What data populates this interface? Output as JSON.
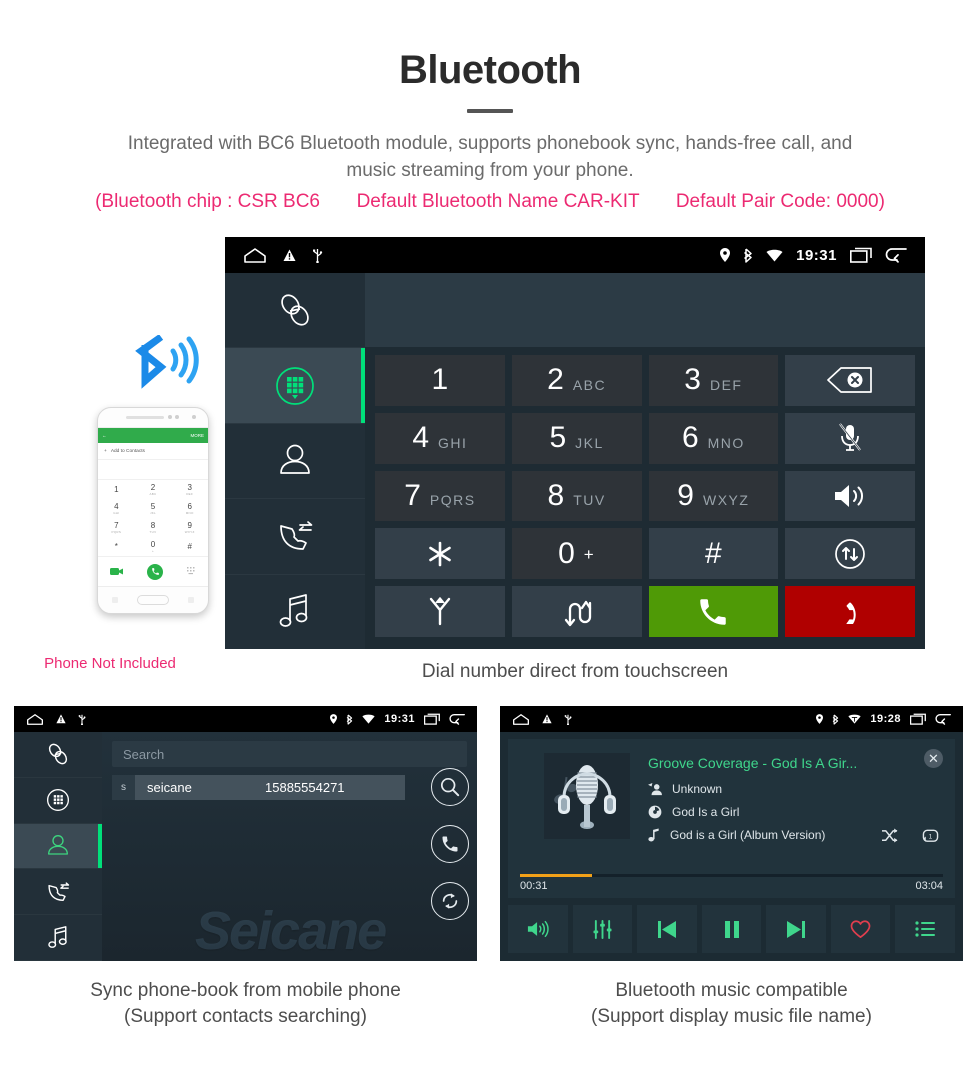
{
  "header": {
    "title": "Bluetooth",
    "subtitle_line1": "Integrated with BC6 Bluetooth module, supports phonebook sync, hands-free call, and",
    "subtitle_line2": "music streaming from your phone.",
    "chip_info": "(Bluetooth chip : CSR BC6",
    "default_name": "Default Bluetooth Name CAR-KIT",
    "pair_code": "Default Pair Code: 0000)",
    "accent_pink": "#ec2a72",
    "title_color": "#2b2b2b"
  },
  "dialer_screen": {
    "statusbar": {
      "home_icon": "home-icon",
      "warning_icon": "warning-icon",
      "usb_icon": "usb-icon",
      "location_icon": "location-icon",
      "bluetooth_icon": "bluetooth-icon",
      "wifi_icon": "wifi-icon",
      "time": "19:31",
      "recents_icon": "recents-icon",
      "back_icon": "back-icon"
    },
    "sidebar": [
      {
        "name": "pair-link",
        "icon": "link-icon",
        "active": false
      },
      {
        "name": "dialpad",
        "icon": "dialpad-icon",
        "active": true
      },
      {
        "name": "contacts",
        "icon": "person-icon",
        "active": false
      },
      {
        "name": "call-history",
        "icon": "call-history-icon",
        "active": false
      },
      {
        "name": "music",
        "icon": "music-note-icon",
        "active": false
      }
    ],
    "number_display": "",
    "keys": [
      {
        "num": "1",
        "letters": "",
        "type": "digit"
      },
      {
        "num": "2",
        "letters": "ABC",
        "type": "digit"
      },
      {
        "num": "3",
        "letters": "DEF",
        "type": "digit"
      },
      {
        "num": "",
        "letters": "",
        "type": "fn",
        "icon": "backspace-icon"
      },
      {
        "num": "4",
        "letters": "GHI",
        "type": "digit"
      },
      {
        "num": "5",
        "letters": "JKL",
        "type": "digit"
      },
      {
        "num": "6",
        "letters": "MNO",
        "type": "digit"
      },
      {
        "num": "",
        "letters": "",
        "type": "fn",
        "icon": "mic-mute-icon"
      },
      {
        "num": "7",
        "letters": "PQRS",
        "type": "digit"
      },
      {
        "num": "8",
        "letters": "TUV",
        "type": "digit"
      },
      {
        "num": "9",
        "letters": "WXYZ",
        "type": "digit"
      },
      {
        "num": "",
        "letters": "",
        "type": "fn",
        "icon": "speaker-icon"
      },
      {
        "num": "",
        "letters": "",
        "type": "fn",
        "icon": "asterisk-icon"
      },
      {
        "num": "0",
        "letters": "+",
        "type": "digit-plus"
      },
      {
        "num": "#",
        "letters": "",
        "type": "fn"
      },
      {
        "num": "",
        "letters": "",
        "type": "fn",
        "icon": "transfer-circle-icon"
      },
      {
        "num": "",
        "letters": "",
        "type": "fn",
        "icon": "merge-call-icon"
      },
      {
        "num": "",
        "letters": "",
        "type": "fn",
        "icon": "swap-call-icon"
      },
      {
        "num": "",
        "letters": "",
        "type": "call",
        "icon": "call-icon"
      },
      {
        "num": "",
        "letters": "",
        "type": "end",
        "icon": "hangup-icon"
      }
    ],
    "caption": "Dial number direct from touchscreen",
    "colors": {
      "call_green": "#4f9a06",
      "end_red": "#b00000",
      "active_green": "#00e07a"
    }
  },
  "phone_illustration": {
    "bluetooth_badge_icon": "bluetooth-signal-icon",
    "screen": {
      "topbar_back_icon": "back-arrow-icon",
      "topbar_more": "MORE",
      "add_contacts": "Add to Contacts",
      "keys": [
        {
          "n": "1",
          "s": ""
        },
        {
          "n": "2",
          "s": "ABC"
        },
        {
          "n": "3",
          "s": "DEF"
        },
        {
          "n": "4",
          "s": "GHI"
        },
        {
          "n": "5",
          "s": "JKL"
        },
        {
          "n": "6",
          "s": "MNO"
        },
        {
          "n": "7",
          "s": "PQRS"
        },
        {
          "n": "8",
          "s": "TUV"
        },
        {
          "n": "9",
          "s": "WXYZ"
        },
        {
          "n": "*",
          "s": ""
        },
        {
          "n": "0",
          "s": "+"
        },
        {
          "n": "#",
          "s": ""
        }
      ],
      "video_call_icon": "video-call-icon",
      "call_icon": "call-icon",
      "keypad_hide_icon": "keypad-hide-icon"
    },
    "caption": "Phone Not Included"
  },
  "contacts_screen": {
    "statusbar": {
      "time": "19:31"
    },
    "sidebar": [
      {
        "name": "pair-link",
        "icon": "link-icon",
        "active": false
      },
      {
        "name": "dialpad",
        "icon": "dialpad-icon",
        "active": false
      },
      {
        "name": "contacts",
        "icon": "person-icon",
        "active": true
      },
      {
        "name": "call-history",
        "icon": "call-history-icon",
        "active": false
      },
      {
        "name": "music",
        "icon": "music-note-icon",
        "active": false
      }
    ],
    "search_placeholder": "Search",
    "contacts": [
      {
        "initial": "s",
        "name": "seicane",
        "number": "15885554271"
      }
    ],
    "actions": [
      {
        "name": "search-button",
        "icon": "search-icon"
      },
      {
        "name": "call-button",
        "icon": "call-icon"
      },
      {
        "name": "sync-button",
        "icon": "sync-icon"
      }
    ],
    "caption_line1": "Sync phone-book from mobile phone",
    "caption_line2": "(Support contacts searching)"
  },
  "music_screen": {
    "statusbar": {
      "time": "19:28"
    },
    "track_title": "Groove Coverage - God Is A Gir...",
    "artist": "Unknown",
    "album": "God Is a Girl",
    "file_name": "God is a Girl (Album Version)",
    "artist_icon": "artist-icon",
    "album_icon": "album-disc-icon",
    "file_icon": "music-note-icon",
    "shuffle_icon": "shuffle-icon",
    "repeat_icon": "repeat-one-icon",
    "close_icon": "close-icon",
    "time_elapsed": "00:31",
    "time_total": "03:04",
    "progress_percent": 17,
    "progress_color": "#f2a118",
    "controls": [
      {
        "name": "volume-button",
        "icon": "volume-icon"
      },
      {
        "name": "equalizer-button",
        "icon": "equalizer-icon"
      },
      {
        "name": "previous-button",
        "icon": "previous-icon"
      },
      {
        "name": "pause-button",
        "icon": "pause-icon"
      },
      {
        "name": "next-button",
        "icon": "next-icon"
      },
      {
        "name": "favorite-button",
        "icon": "heart-icon"
      },
      {
        "name": "playlist-button",
        "icon": "playlist-icon"
      }
    ],
    "accent_green": "#3fd68c",
    "heart_red": "#e03e4e",
    "caption_line1": "Bluetooth music compatible",
    "caption_line2": "(Support display music file name)"
  },
  "watermark": {
    "text": "Seicane"
  }
}
